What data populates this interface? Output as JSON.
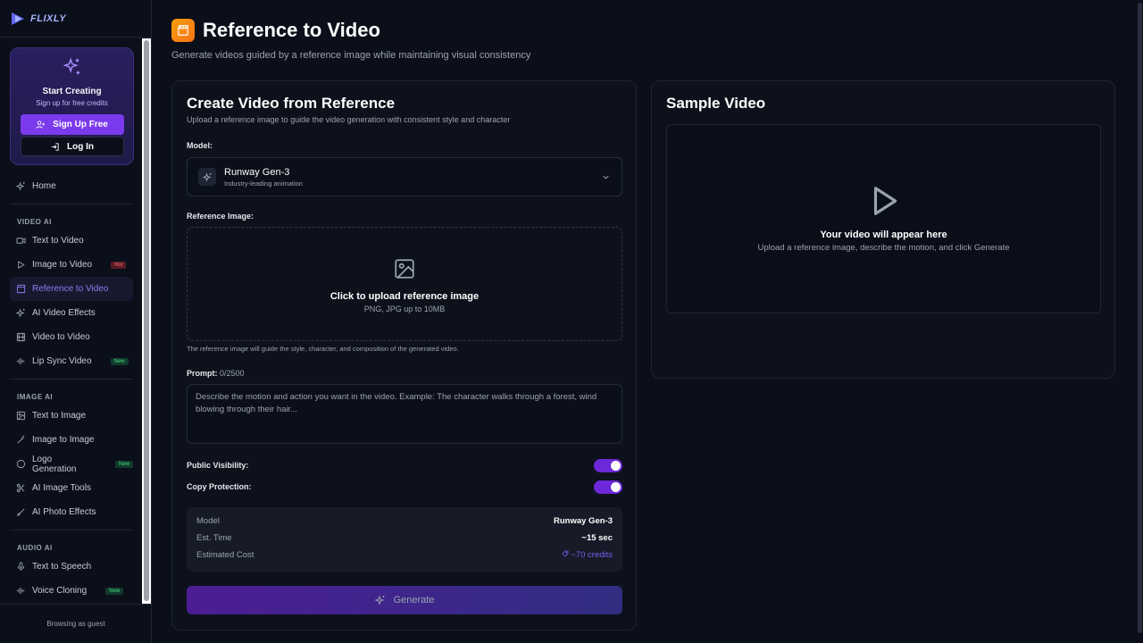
{
  "brand": {
    "name": "FLIXLY"
  },
  "promo": {
    "title": "Start Creating",
    "subtitle": "Sign up for free credits",
    "signup_label": "Sign Up Free",
    "login_label": "Log In"
  },
  "nav": {
    "home": "Home",
    "sections": [
      {
        "title": "VIDEO AI",
        "items": [
          {
            "label": "Text to Video",
            "icon": "video-camera-icon"
          },
          {
            "label": "Image to Video",
            "icon": "play-icon",
            "badge": "Hot"
          },
          {
            "label": "Reference to Video",
            "icon": "clapperboard-icon",
            "active": true
          },
          {
            "label": "AI Video Effects",
            "icon": "sparkles-icon"
          },
          {
            "label": "Video to Video",
            "icon": "film-icon"
          },
          {
            "label": "Lip Sync Video",
            "icon": "audio-waveform-icon",
            "badge": "New"
          }
        ]
      },
      {
        "title": "IMAGE AI",
        "items": [
          {
            "label": "Text to Image",
            "icon": "image-icon"
          },
          {
            "label": "Image to Image",
            "icon": "wand-icon"
          },
          {
            "label": "Logo Generation",
            "icon": "circle-icon",
            "badge": "New"
          },
          {
            "label": "AI Image Tools",
            "icon": "scissors-icon"
          },
          {
            "label": "AI Photo Effects",
            "icon": "brush-icon"
          }
        ]
      },
      {
        "title": "AUDIO AI",
        "items": [
          {
            "label": "Text to Speech",
            "icon": "microphone-icon"
          },
          {
            "label": "Voice Cloning",
            "icon": "audio-waveform-icon",
            "badge": "New"
          }
        ]
      }
    ],
    "footer": "Browsing as guest"
  },
  "header": {
    "title": "Reference to Video",
    "subtitle": "Generate videos guided by a reference image while maintaining visual consistency"
  },
  "form": {
    "title": "Create Video from Reference",
    "subtitle": "Upload a reference image to guide the video generation with consistent style and character",
    "model_label": "Model:",
    "model_name": "Runway Gen-3",
    "model_desc": "Industry-leading animation",
    "ref_label": "Reference Image:",
    "upload_title": "Click to upload reference image",
    "upload_sub": "PNG, JPG up to 10MB",
    "upload_hint": "The reference image will guide the style, character, and composition of the generated video.",
    "prompt_label": "Prompt:",
    "prompt_count": "0/2500",
    "prompt_placeholder": "Describe the motion and action you want in the video. Example: The character walks through a forest, wind blowing through their hair...",
    "public_label": "Public Visibility:",
    "copy_label": "Copy Protection:",
    "public_on": true,
    "copy_on": true,
    "summary": [
      {
        "key": "Model",
        "value": "Runway Gen-3"
      },
      {
        "key": "Est. Time",
        "value": "~15 sec"
      },
      {
        "key": "Estimated Cost",
        "value": "~70 credits"
      }
    ],
    "generate_label": "Generate"
  },
  "sample": {
    "title": "Sample Video",
    "placeholder_title": "Your video will appear here",
    "placeholder_sub": "Upload a reference image, describe the motion, and click Generate"
  },
  "colors": {
    "accent": "#7c3aed",
    "title_icon": "#f59e0b",
    "background": "#0b0f1a"
  }
}
